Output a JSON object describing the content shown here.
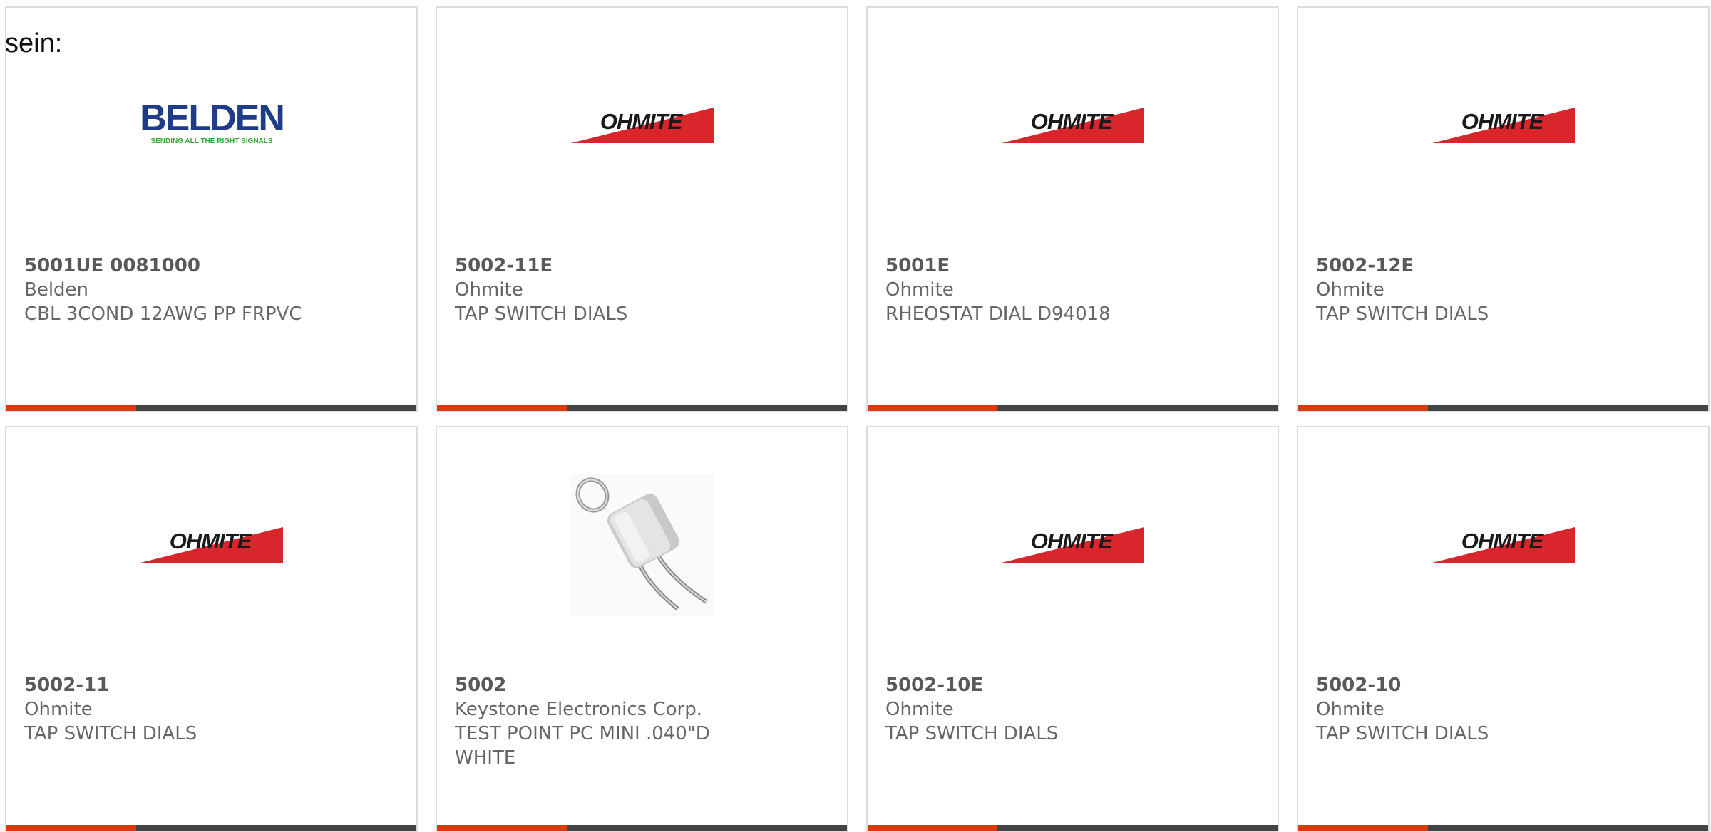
{
  "page": {
    "intro_text": "sein:"
  },
  "colors": {
    "accent_bar": "#dd3a0b",
    "dark_bar": "#444444",
    "ohmite_red": "#d9262c",
    "belden_blue": "#1f3c88",
    "belden_green": "#3aa335"
  },
  "products": [
    {
      "logo": "belden-logo",
      "logo_text": "BELDEN",
      "logo_tagline": "SENDING ALL THE RIGHT SIGNALS",
      "part_number": "5001UE 0081000",
      "manufacturer": "Belden",
      "description": "CBL 3COND 12AWG PP FRPVC"
    },
    {
      "logo": "ohmite-logo",
      "logo_text": "OHMITE",
      "part_number": "5002-11E",
      "manufacturer": "Ohmite",
      "description": "TAP SWITCH DIALS"
    },
    {
      "logo": "ohmite-logo",
      "logo_text": "OHMITE",
      "part_number": "5001E",
      "manufacturer": "Ohmite",
      "description": "RHEOSTAT DIAL D94018"
    },
    {
      "logo": "ohmite-logo",
      "logo_text": "OHMITE",
      "part_number": "5002-12E",
      "manufacturer": "Ohmite",
      "description": "TAP SWITCH DIALS"
    },
    {
      "logo": "ohmite-logo",
      "logo_text": "OHMITE",
      "part_number": "5002-11",
      "manufacturer": "Ohmite",
      "description": "TAP SWITCH DIALS"
    },
    {
      "logo": "test-point-photo",
      "part_number": "5002",
      "manufacturer": "Keystone Electronics Corp.",
      "description": "TEST POINT PC MINI .040\"D WHITE"
    },
    {
      "logo": "ohmite-logo",
      "logo_text": "OHMITE",
      "part_number": "5002-10E",
      "manufacturer": "Ohmite",
      "description": "TAP SWITCH DIALS"
    },
    {
      "logo": "ohmite-logo",
      "logo_text": "OHMITE",
      "part_number": "5002-10",
      "manufacturer": "Ohmite",
      "description": "TAP SWITCH DIALS"
    }
  ]
}
